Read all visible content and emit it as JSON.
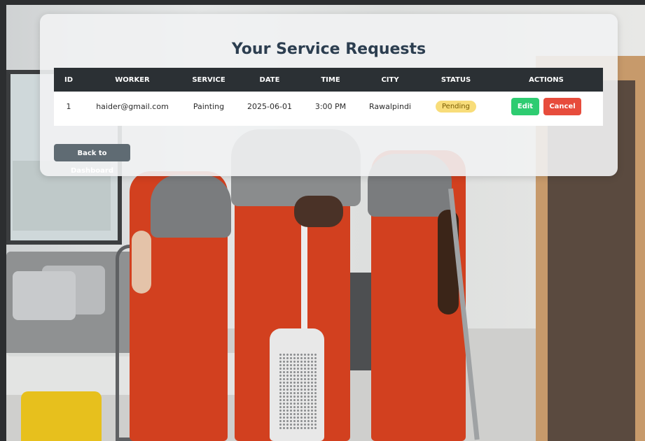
{
  "page": {
    "title": "Your Service Requests",
    "back_label": "Back to Dashboard"
  },
  "table": {
    "columns": [
      "ID",
      "WORKER",
      "SERVICE",
      "DATE",
      "TIME",
      "CITY",
      "STATUS",
      "ACTIONS"
    ],
    "rows": [
      {
        "id": "1",
        "worker": "haider@gmail.com",
        "service": "Painting",
        "date": "2025-06-01",
        "time": "3:00 PM",
        "city": "Rawalpindi",
        "status": "Pending",
        "actions": {
          "edit": "Edit",
          "cancel": "Cancel"
        }
      }
    ]
  },
  "colors": {
    "header_bg": "#2b3034",
    "title": "#2c3e50",
    "status_pending": "#f8dd7a",
    "edit": "#2ecc71",
    "cancel": "#e74c3c",
    "back": "#5f6b73"
  }
}
